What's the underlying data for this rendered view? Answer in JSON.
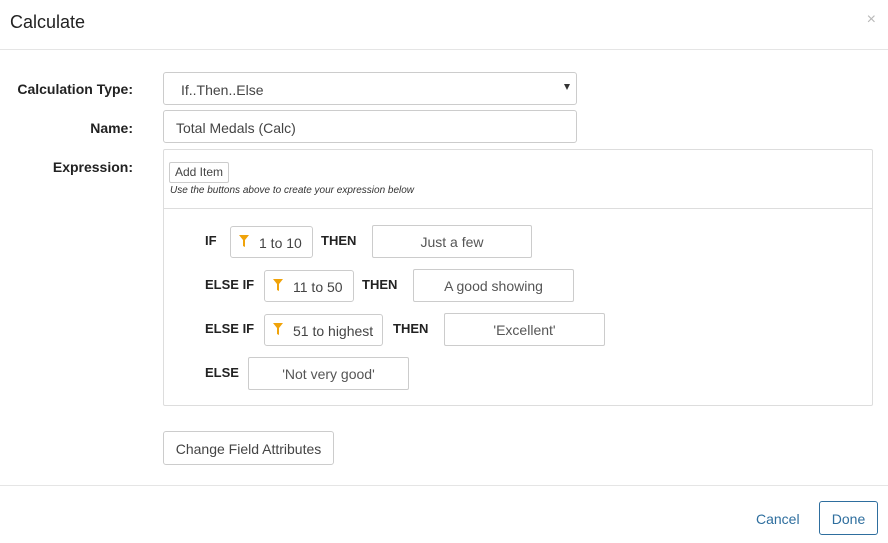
{
  "dialog": {
    "title": "Calculate",
    "close_symbol": "×"
  },
  "form": {
    "calc_type_label": "Calculation Type:",
    "calc_type_value": "If..Then..Else",
    "name_label": "Name:",
    "name_value": "Total Medals (Calc)",
    "expression_label": "Expression:"
  },
  "expression": {
    "add_item_label": "Add Item",
    "hint": "Use the buttons above to create your expression below",
    "rows": [
      {
        "keyword": "IF",
        "filter": "1 to 10",
        "then": "THEN",
        "value": "Just a few"
      },
      {
        "keyword": "ELSE IF",
        "filter": "11 to 50",
        "then": "THEN",
        "value": "A good showing"
      },
      {
        "keyword": "ELSE IF",
        "filter": "51 to highest",
        "then": "THEN",
        "value": "'Excellent'"
      }
    ],
    "else": {
      "keyword": "ELSE",
      "value": "'Not very good'"
    }
  },
  "buttons": {
    "change_field_attributes": "Change Field Attributes",
    "cancel": "Cancel",
    "done": "Done"
  },
  "colors": {
    "accent": "#2e6e9e",
    "filter_icon": "#f0a30a"
  },
  "icons": {
    "filter": "funnel-icon",
    "close": "close-icon",
    "dropdown": "caret-down-icon"
  }
}
